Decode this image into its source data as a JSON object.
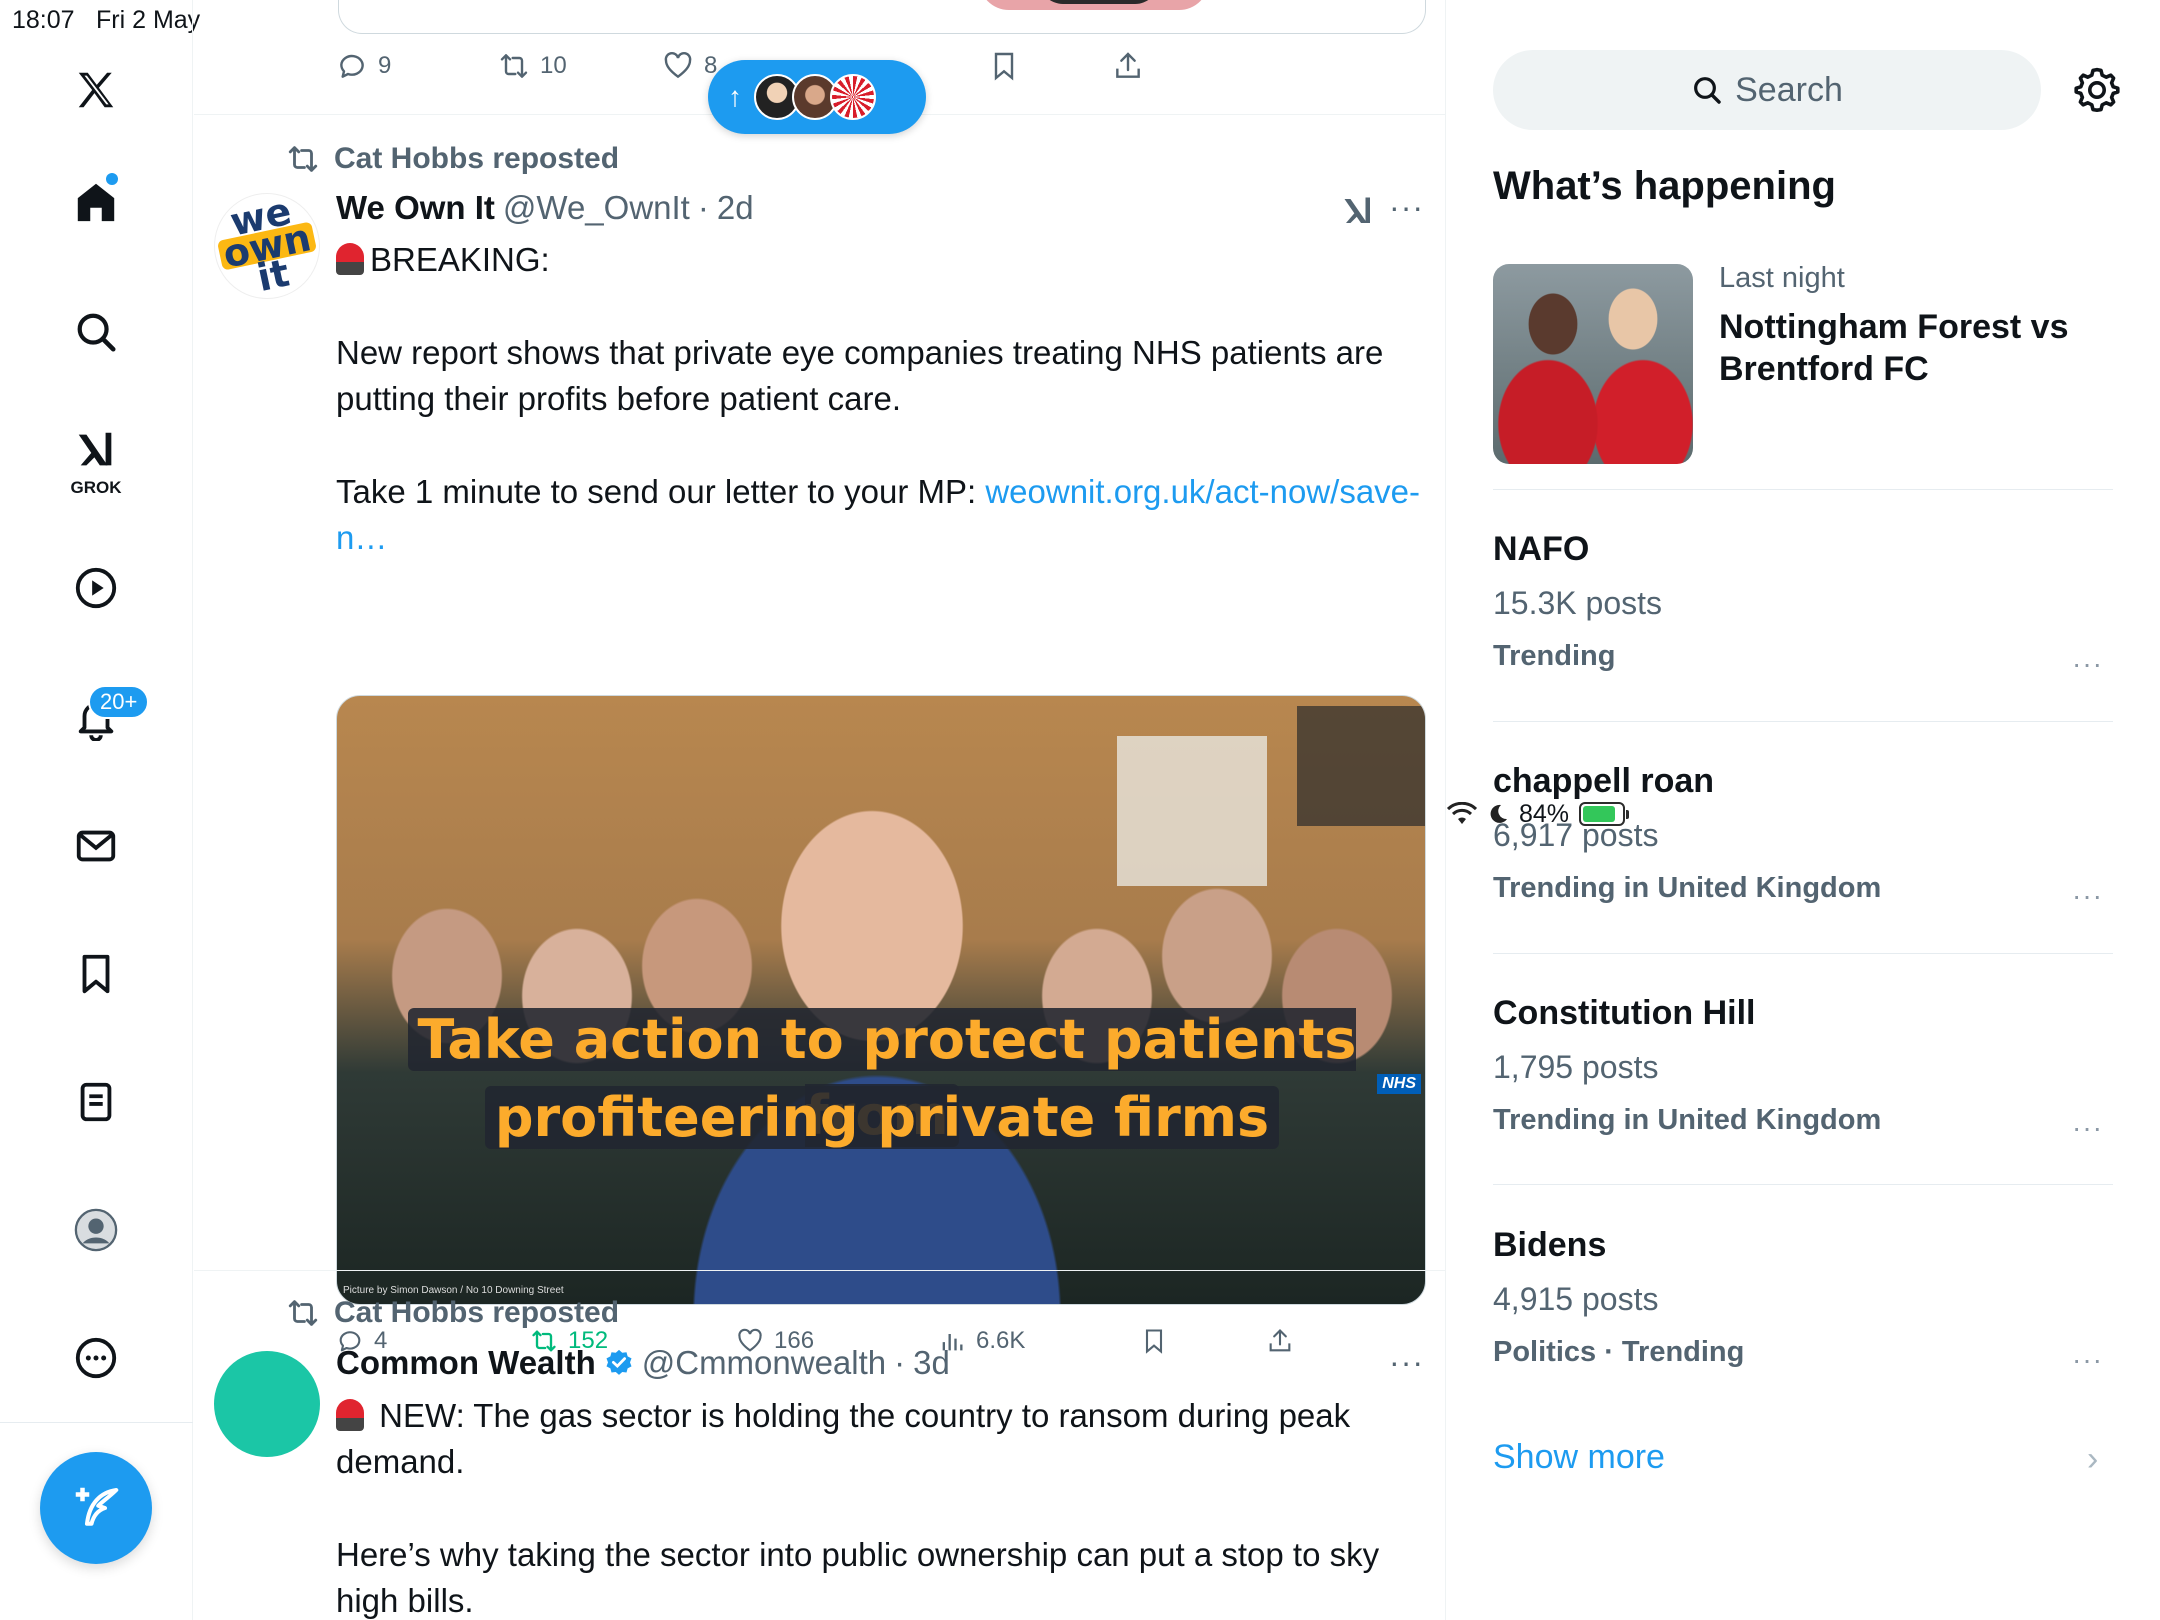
{
  "status": {
    "time": "18:07",
    "date": "Fri 2 May",
    "battery": "84%",
    "battery_level": 0.84
  },
  "nav": {
    "grok_label": "GROK",
    "notifications_badge": "20+",
    "items": [
      "x-logo",
      "home",
      "search",
      "grok",
      "video",
      "notifications",
      "messages",
      "bookmarks",
      "lists",
      "profile",
      "more"
    ]
  },
  "feed": {
    "prev_post_actions": {
      "replies": "9",
      "reposts": "10",
      "likes": "8"
    },
    "post1": {
      "repost_by": "Cat Hobbs reposted",
      "name": "We Own It",
      "handle": "@We_OwnIt",
      "time": "2d",
      "avatar_text": {
        "top": "we",
        "mid": "own",
        "bottom": "it"
      },
      "line1": "BREAKING:",
      "line2": "New report shows that private eye companies treating NHS patients are putting their profits before patient care.",
      "line3_prefix": "Take 1 minute to send our letter to your MP: ",
      "line3_link": "weownit.org.uk/act-now/save-n…",
      "image_overlay_1": "Take action to protect patients from",
      "image_overlay_2": "profiteering private firms",
      "image_badge": "NHS",
      "image_credit": "Picture by Simon Dawson / No 10 Downing Street",
      "actions": {
        "replies": "4",
        "reposts": "152",
        "likes": "166",
        "views": "6.6K"
      }
    },
    "post2": {
      "repost_by": "Cat Hobbs reposted",
      "name": "Common Wealth",
      "handle": "@Cmmonwealth",
      "time": "3d",
      "line1": "NEW: The gas sector is holding the country to ransom during peak demand.",
      "line2": "Here’s why taking the sector into public ownership can put a stop to sky high bills."
    }
  },
  "sidebar": {
    "search_placeholder": "Search",
    "title": "What’s happening",
    "event": {
      "meta": "Last night",
      "title": "Nottingham Forest vs Brentford FC"
    },
    "trends": [
      {
        "name": "NAFO",
        "count": "15.3K posts",
        "meta": "Trending"
      },
      {
        "name": "chappell roan",
        "count": "6,917 posts",
        "meta": "Trending in United Kingdom"
      },
      {
        "name": "Constitution Hill",
        "count": "1,795 posts",
        "meta": "Trending in United Kingdom"
      },
      {
        "name": "Bidens",
        "count": "4,915 posts",
        "meta": "Politics · Trending"
      }
    ],
    "show_more": "Show more"
  },
  "colors": {
    "accent": "#1d9bf0",
    "repost_green": "#00ba7c",
    "overlay_text": "#fcab2c",
    "teal_avatar": "#1bc6a6"
  }
}
